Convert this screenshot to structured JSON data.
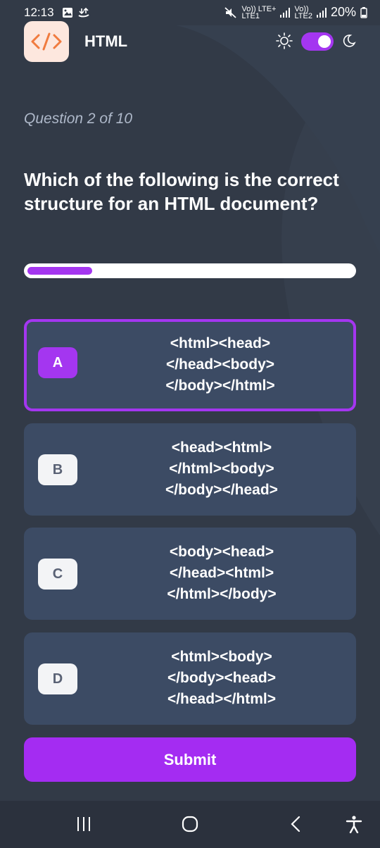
{
  "status_bar": {
    "time": "12:13",
    "network_label_1": "Vo)) LTE+",
    "network_label_1b": "LTE1",
    "network_label_2": "Vo))",
    "network_label_2b": "LTE2",
    "battery": "20%"
  },
  "header": {
    "logo_text": "</>",
    "title": "HTML",
    "dark_mode_enabled": true
  },
  "quiz": {
    "counter": "Question 2 of 10",
    "question": "Which of the following is the correct structure for an HTML document?",
    "progress_fraction": 0.2,
    "selected": "A",
    "options": [
      {
        "letter": "A",
        "lines": [
          "<html><head>",
          "</head><body>",
          "</body></html>"
        ]
      },
      {
        "letter": "B",
        "lines": [
          "<head><html>",
          "</html><body>",
          "</body></head>"
        ]
      },
      {
        "letter": "C",
        "lines": [
          "<body><head>",
          "</head><html>",
          "</html></body>"
        ]
      },
      {
        "letter": "D",
        "lines": [
          "<html><body>",
          "</body><head>",
          "</head></html>"
        ]
      }
    ],
    "submit_label": "Submit"
  },
  "colors": {
    "accent": "#a436f0",
    "background": "#323a47",
    "card": "#3c4b64"
  },
  "nav_icons": [
    "recent-apps-icon",
    "home-icon",
    "back-icon",
    "accessibility-icon"
  ]
}
